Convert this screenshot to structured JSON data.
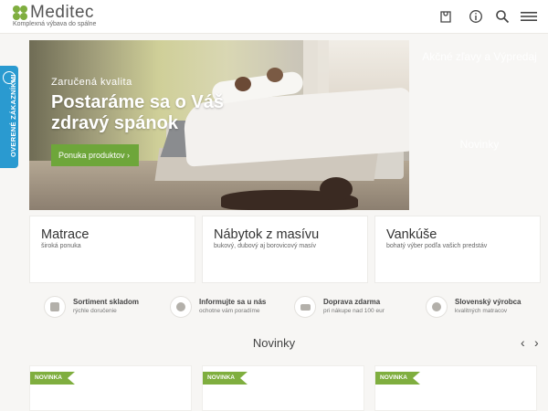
{
  "brand": {
    "name": "Meditec",
    "tagline": "Komplexná výbava do spálne",
    "accent": "#7fae3f",
    "side_accent": "#2a9ad0"
  },
  "header": {
    "icons": [
      "bag-icon",
      "info-icon",
      "search-icon",
      "menu-icon"
    ]
  },
  "side_tab": {
    "label": "OVERENÉ ZÁKAZNÍKMI"
  },
  "hero": {
    "caption": "Zaručená kvalita",
    "title": "Postaráme sa o Váš zdravý spánok",
    "button_label": "Ponuka produktov ›"
  },
  "hero_ghost": {
    "promo": "Akčné zľavy a Výpredaj",
    "news": "Novinky"
  },
  "categories": [
    {
      "title": "Matrace",
      "subtitle": "široká ponuka"
    },
    {
      "title": "Nábytok z masívu",
      "subtitle": "bukový, dubový aj borovicový masív"
    },
    {
      "title": "Vankúše",
      "subtitle": "bohatý výber podľa vašich predstáv"
    }
  ],
  "features": [
    {
      "title": "Sortiment skladom",
      "subtitle": "rýchle doručenie",
      "icon": "box-icon"
    },
    {
      "title": "Informujte sa u nás",
      "subtitle": "ochotne vám poradíme",
      "icon": "info-icon"
    },
    {
      "title": "Doprava zdarma",
      "subtitle": "pri nákupe nad 100 eur",
      "icon": "truck-icon"
    },
    {
      "title": "Slovenský výrobca",
      "subtitle": "kvalitných matracov",
      "icon": "factory-icon"
    }
  ],
  "news": {
    "title": "Novinky",
    "badge": "NOVINKA",
    "prev": "‹",
    "next": "›"
  }
}
